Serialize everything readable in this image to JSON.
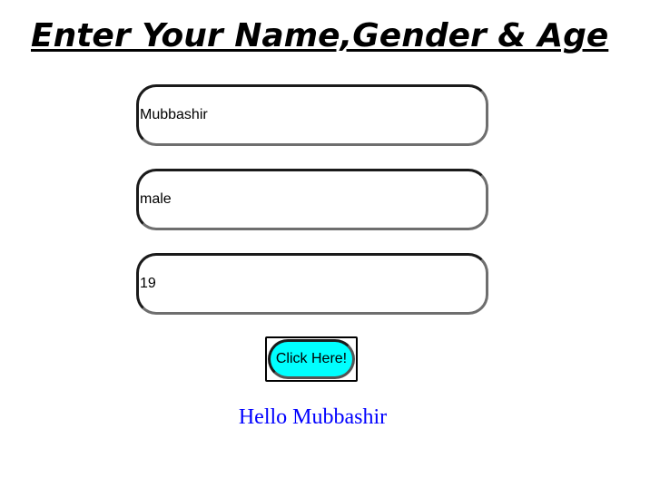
{
  "header": {
    "title": "Enter Your Name,Gender & Age"
  },
  "form": {
    "name_value": "Mubbashir",
    "gender_value": "male",
    "age_value": "19",
    "submit_label": "Click Here!"
  },
  "output": {
    "greeting": "Hello Mubbashir"
  },
  "colors": {
    "button_bg": "#00ffff",
    "greeting_text": "#0000ff",
    "title_text": "#000000"
  }
}
